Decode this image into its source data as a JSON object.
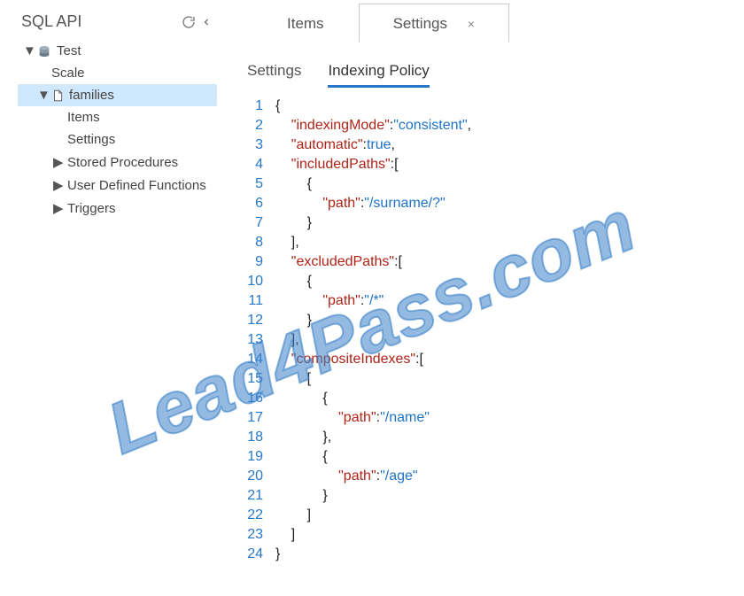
{
  "sidebar": {
    "title": "SQL API",
    "root": {
      "label": "Test",
      "children": [
        {
          "label": "Scale"
        },
        {
          "label": "families",
          "selected": true,
          "children": [
            {
              "label": "Items"
            },
            {
              "label": "Settings"
            },
            {
              "label": "Stored Procedures",
              "caret": true
            },
            {
              "label": "User Defined Functions",
              "caret": true
            },
            {
              "label": "Triggers",
              "caret": true
            }
          ]
        }
      ]
    }
  },
  "tabs": {
    "items_label": "Items",
    "settings_label": "Settings"
  },
  "subtabs": {
    "settings_label": "Settings",
    "indexing_label": "Indexing Policy"
  },
  "indexing_policy": {
    "indexingMode": "consistent",
    "automatic": true,
    "includedPaths": [
      {
        "path": "/surname/?"
      }
    ],
    "excludedPaths": [
      {
        "path": "/*"
      }
    ],
    "compositeIndexes": [
      [
        {
          "path": "/name"
        },
        {
          "path": "/age"
        }
      ]
    ]
  },
  "code_lines": [
    [
      {
        "t": "pun",
        "v": "{"
      }
    ],
    [
      {
        "t": "pun",
        "v": "    "
      },
      {
        "t": "key",
        "v": "\"indexingMode\""
      },
      {
        "t": "pun",
        "v": ":"
      },
      {
        "t": "str",
        "v": "\"consistent\""
      },
      {
        "t": "pun",
        "v": ","
      }
    ],
    [
      {
        "t": "pun",
        "v": "    "
      },
      {
        "t": "key",
        "v": "\"automatic\""
      },
      {
        "t": "pun",
        "v": ":"
      },
      {
        "t": "bool",
        "v": "true"
      },
      {
        "t": "pun",
        "v": ","
      }
    ],
    [
      {
        "t": "pun",
        "v": "    "
      },
      {
        "t": "key",
        "v": "\"includedPaths\""
      },
      {
        "t": "pun",
        "v": ":["
      }
    ],
    [
      {
        "t": "pun",
        "v": "        {"
      }
    ],
    [
      {
        "t": "pun",
        "v": "            "
      },
      {
        "t": "key",
        "v": "\"path\""
      },
      {
        "t": "pun",
        "v": ":"
      },
      {
        "t": "str",
        "v": "\"/surname/?\""
      }
    ],
    [
      {
        "t": "pun",
        "v": "        }"
      }
    ],
    [
      {
        "t": "pun",
        "v": "    ],"
      }
    ],
    [
      {
        "t": "pun",
        "v": "    "
      },
      {
        "t": "key",
        "v": "\"excludedPaths\""
      },
      {
        "t": "pun",
        "v": ":["
      }
    ],
    [
      {
        "t": "pun",
        "v": "        {"
      }
    ],
    [
      {
        "t": "pun",
        "v": "            "
      },
      {
        "t": "key",
        "v": "\"path\""
      },
      {
        "t": "pun",
        "v": ":"
      },
      {
        "t": "str",
        "v": "\"/*\""
      }
    ],
    [
      {
        "t": "pun",
        "v": "        }"
      }
    ],
    [
      {
        "t": "pun",
        "v": "    ],"
      }
    ],
    [
      {
        "t": "pun",
        "v": "    "
      },
      {
        "t": "key",
        "v": "\"compositeIndexes\""
      },
      {
        "t": "pun",
        "v": ":["
      }
    ],
    [
      {
        "t": "pun",
        "v": "        ["
      }
    ],
    [
      {
        "t": "pun",
        "v": "            {"
      }
    ],
    [
      {
        "t": "pun",
        "v": "                "
      },
      {
        "t": "key",
        "v": "\"path\""
      },
      {
        "t": "pun",
        "v": ":"
      },
      {
        "t": "str",
        "v": "\"/name\""
      }
    ],
    [
      {
        "t": "pun",
        "v": "            },"
      }
    ],
    [
      {
        "t": "pun",
        "v": "            {"
      }
    ],
    [
      {
        "t": "pun",
        "v": "                "
      },
      {
        "t": "key",
        "v": "\"path\""
      },
      {
        "t": "pun",
        "v": ":"
      },
      {
        "t": "str",
        "v": "\"/age\""
      }
    ],
    [
      {
        "t": "pun",
        "v": "            }"
      }
    ],
    [
      {
        "t": "pun",
        "v": "        ]"
      }
    ],
    [
      {
        "t": "pun",
        "v": "    ]"
      }
    ],
    [
      {
        "t": "pun",
        "v": "}"
      }
    ]
  ],
  "watermark": "Lead4Pass.com"
}
